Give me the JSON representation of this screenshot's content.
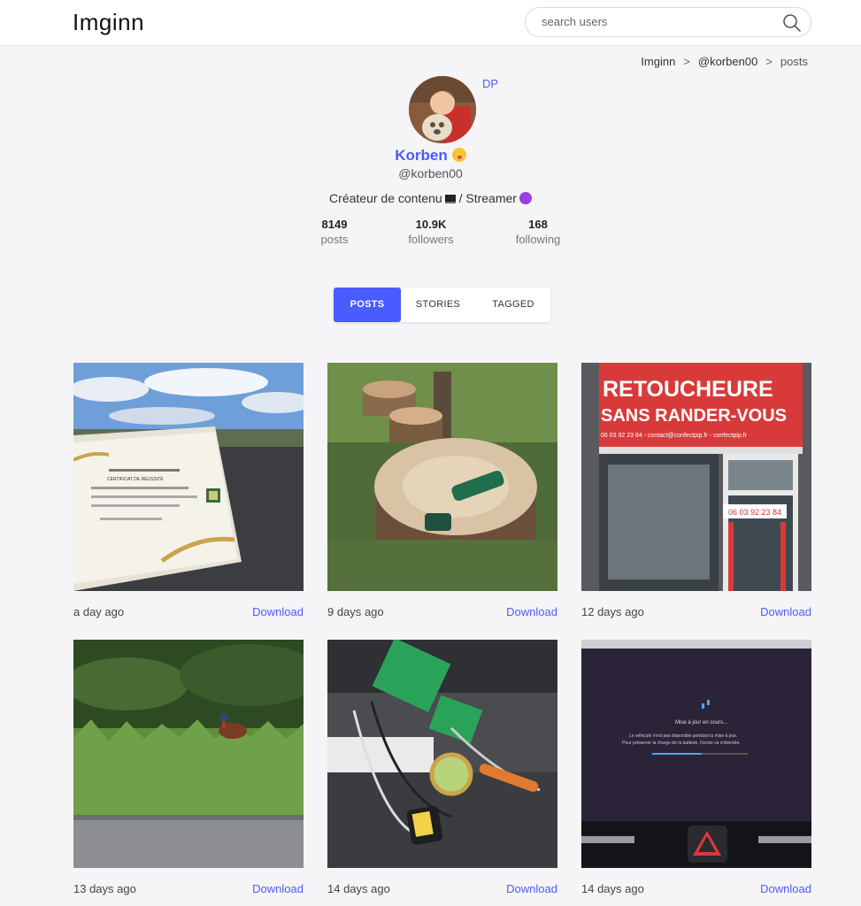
{
  "header": {
    "logo": "Imginn",
    "search_placeholder": "search users"
  },
  "breadcrumb": {
    "home": "Imginn",
    "user": "@korben00",
    "current": "posts",
    "separator": ">"
  },
  "profile": {
    "dp_label": "DP",
    "name": "Korben",
    "handle": "@korben00",
    "bio_part1": "Créateur de contenu",
    "bio_part2": " / Streamer",
    "stats": [
      {
        "value": "8149",
        "label": "posts"
      },
      {
        "value": "10.9K",
        "label": "followers"
      },
      {
        "value": "168",
        "label": "following"
      }
    ]
  },
  "tabs": [
    {
      "label": "POSTS",
      "active": true
    },
    {
      "label": "STORIES",
      "active": false
    },
    {
      "label": "TAGGED",
      "active": false
    }
  ],
  "posts": [
    {
      "time": "a day ago",
      "download": "Download"
    },
    {
      "time": "9 days ago",
      "download": "Download"
    },
    {
      "time": "12 days ago",
      "download": "Download"
    },
    {
      "time": "13 days ago",
      "download": "Download"
    },
    {
      "time": "14 days ago",
      "download": "Download"
    },
    {
      "time": "14 days ago",
      "download": "Download"
    }
  ],
  "post_texts": {
    "certificate_title": "CERTIFICAT DE RÉUSSITE",
    "shop_sign_line1": "RETOUCHEURE",
    "shop_sign_line2": "SANS RANDER-VOUS",
    "shop_sign_phone": "06 03 92 23 84 - contact@confectpip.fr - confectpip.fr",
    "door_phone": "06 03 92 23 84",
    "car_screen_title": "Mise à jour en cours...",
    "car_screen_line1": "Le véhicule n'est pas disponible pendant la mise à jour.",
    "car_screen_line2": "Pour préserver la charge de la batterie, l'écran va s'éteindre."
  },
  "colors": {
    "accent": "#4a5bff",
    "background": "#f5f5f7"
  }
}
